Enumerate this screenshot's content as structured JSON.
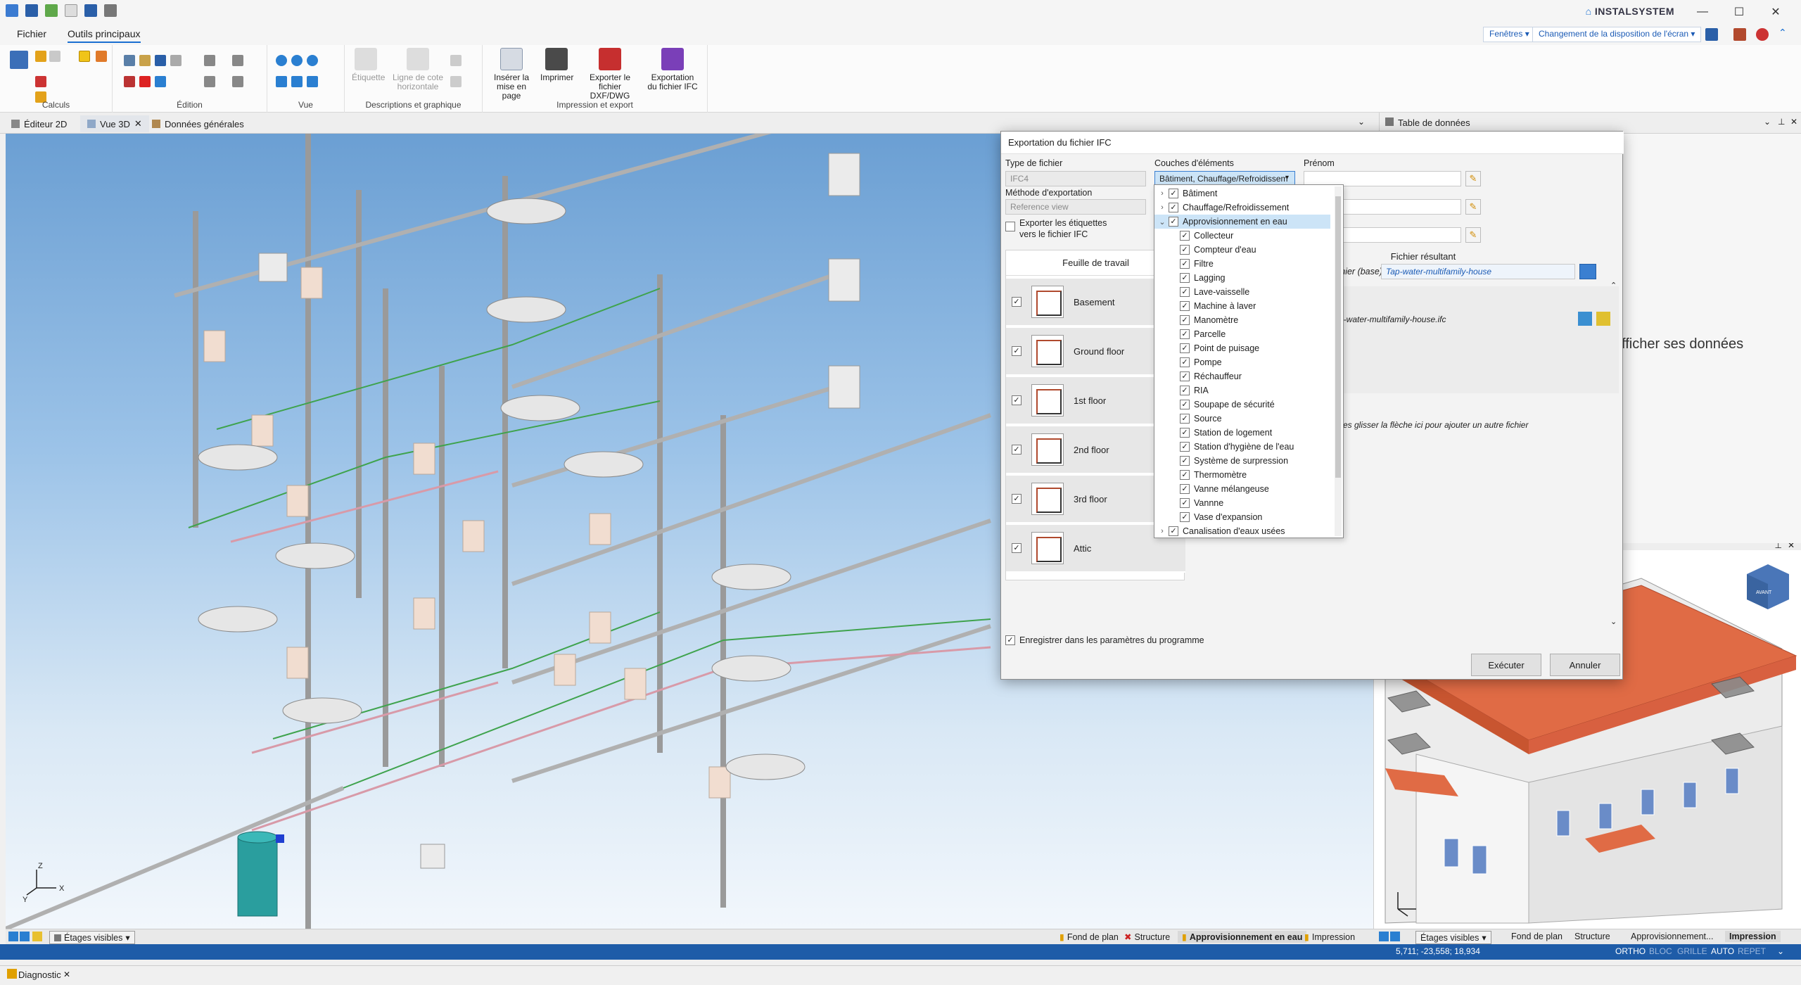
{
  "app": {
    "brand": "INSTALSYSTEM"
  },
  "ribbon_tabs": [
    "Fichier",
    "Outils principaux"
  ],
  "top_right": {
    "windows": "Fenêtres",
    "layout": "Changement de la disposition de l'écran"
  },
  "ribbon_groups": {
    "calc": "Calculs",
    "edit": "Édition",
    "view": "Vue",
    "desc": "Descriptions et graphique",
    "print": "Impression et export"
  },
  "ribbon_buttons": {
    "label": "Étiquette",
    "dimline": "Ligne de cote horizontale",
    "insert_page": "Insérer la mise en page",
    "print": "Imprimer",
    "export_dxf": "Exporter le fichier DXF/DWG",
    "export_ifc": "Exportation du fichier IFC"
  },
  "doc_tabs": [
    "Éditeur 2D",
    "Vue 3D",
    "Données générales"
  ],
  "right_panel": {
    "title": "Table de données",
    "hint": "fficher ses données"
  },
  "bottom_tabs": [
    "Étages visibles",
    "Fond de plan",
    "Structure",
    "Approvisionnement en eau",
    "Impression"
  ],
  "bld_bottom_tabs": [
    "Étages visibles",
    "Fond de plan",
    "Structure",
    "Approvisionnement...",
    "Impression"
  ],
  "status": {
    "coords": "5,711; -23,558; 18,934",
    "modes": [
      "ORTHO",
      "BLOC",
      "GRILLE",
      "AUTO",
      "REPET"
    ]
  },
  "diagnostic": "Diagnostic",
  "dialog": {
    "title": "Exportation du fichier IFC",
    "file_type_label": "Type de fichier",
    "file_type_value": "IFC4",
    "export_method_label": "Méthode d'exportation",
    "export_method_value": "Reference view",
    "export_labels": "Exporter les étiquettes vers le fichier IFC",
    "layers_label": "Couches d'éléments",
    "layers_value": "Bâtiment, Chauffage/Refroidissem",
    "prenom_label": "Prénom",
    "worksheet_header": "Feuille de travail",
    "result_header": "Fichier résultant",
    "base_label": "chier (base)",
    "base_value": "Tap-water-multifamily-house",
    "result_file": "p-water-multifamily-house.ifc",
    "drag_hint": "ites glisser la flèche ici pour ajouter un autre fichier",
    "save_settings": "Enregistrer dans les paramètres du programme",
    "execute": "Exécuter",
    "cancel": "Annuler",
    "sheets": [
      "Basement",
      "Ground floor",
      "1st floor",
      "2nd floor",
      "3rd floor",
      "Attic"
    ]
  },
  "layers": [
    {
      "label": "Bâtiment",
      "level": 0,
      "expand": "›"
    },
    {
      "label": "Chauffage/Refroidissement",
      "level": 0,
      "expand": "›"
    },
    {
      "label": "Approvisionnement en eau",
      "level": 0,
      "expand": "⌄"
    },
    {
      "label": "Collecteur",
      "level": 1
    },
    {
      "label": "Compteur d'eau",
      "level": 1
    },
    {
      "label": "Filtre",
      "level": 1
    },
    {
      "label": "Lagging",
      "level": 1
    },
    {
      "label": "Lave-vaisselle",
      "level": 1
    },
    {
      "label": "Machine à laver",
      "level": 1
    },
    {
      "label": "Manomètre",
      "level": 1
    },
    {
      "label": "Parcelle",
      "level": 1
    },
    {
      "label": "Point de puisage",
      "level": 1
    },
    {
      "label": "Pompe",
      "level": 1
    },
    {
      "label": "Réchauffeur",
      "level": 1
    },
    {
      "label": "RIA",
      "level": 1
    },
    {
      "label": "Soupape de sécurité",
      "level": 1
    },
    {
      "label": "Source",
      "level": 1
    },
    {
      "label": "Station de logement",
      "level": 1
    },
    {
      "label": "Station d'hygiène de l'eau",
      "level": 1
    },
    {
      "label": "Système de surpression",
      "level": 1
    },
    {
      "label": "Thermomètre",
      "level": 1
    },
    {
      "label": "Vanne mélangeuse",
      "level": 1
    },
    {
      "label": "Vannne",
      "level": 1
    },
    {
      "label": "Vase d'expansion",
      "level": 1
    },
    {
      "label": "Canalisation d'eaux usées",
      "level": 0,
      "expand": "›"
    }
  ],
  "view_cube": "AVANT",
  "axes": {
    "x": "X",
    "y": "Y",
    "z": "Z"
  },
  "colors": {
    "accent": "#1a6fd1",
    "status": "#1e5ca8",
    "roof": "#e06b45",
    "selected": "#cce4f7"
  }
}
